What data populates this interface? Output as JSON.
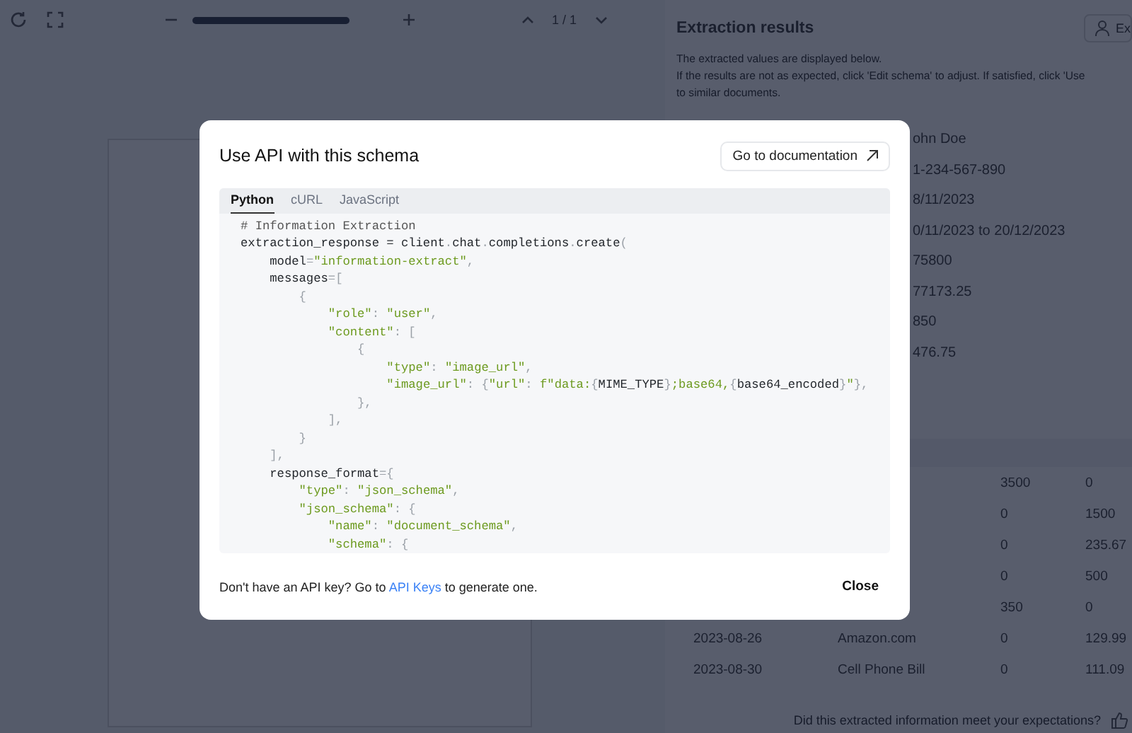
{
  "toolbar": {
    "zoom": {
      "level": 1
    },
    "page_indicator": "1 / 1"
  },
  "results": {
    "title": "Extraction results",
    "action_label": "Ex",
    "description": [
      "The extracted values are displayed below.",
      "If the results are not as expected, click 'Edit schema' to adjust. If satisfied, click 'Use",
      "to similar documents."
    ],
    "field_values": [
      "ohn Doe",
      "1-234-567-890",
      "8/11/2023",
      "0/11/2023 to 20/12/2023",
      "75800",
      "77173.25",
      "850",
      "476.75"
    ],
    "table_rows": [
      {
        "column_3": "3500",
        "column_4": "0"
      },
      {
        "column_3": "0",
        "column_4": "1500"
      },
      {
        "column_3": "0",
        "column_4": "235.67"
      },
      {
        "column_3": "0",
        "column_4": "500"
      },
      {
        "column_3": "350",
        "column_4": "0"
      },
      {
        "column_1": "2023-08-26",
        "column_2": "Amazon.com",
        "column_3": "0",
        "column_4": "129.99"
      },
      {
        "column_1": "2023-08-30",
        "column_2": "Cell Phone Bill",
        "column_3": "0",
        "column_4": "111.09"
      }
    ],
    "feedback_prompt": "Did this extracted information meet your expectations?"
  },
  "modal": {
    "title": "Use API with this schema",
    "doc_button": "Go to documentation",
    "tabs": [
      {
        "label": "Python",
        "selected": true
      },
      {
        "label": "cURL",
        "selected": false
      },
      {
        "label": "JavaScript",
        "selected": false
      }
    ],
    "code_lines": [
      [
        {
          "kind": "comment",
          "text": "# Information Extraction"
        }
      ],
      [
        {
          "kind": "plain",
          "text": "extraction_response = client"
        },
        {
          "kind": "punct",
          "text": "."
        },
        {
          "kind": "plain",
          "text": "chat"
        },
        {
          "kind": "punct",
          "text": "."
        },
        {
          "kind": "plain",
          "text": "completions"
        },
        {
          "kind": "punct",
          "text": "."
        },
        {
          "kind": "plain",
          "text": "create"
        },
        {
          "kind": "punct",
          "text": "("
        }
      ],
      [
        {
          "kind": "plain",
          "text": "    model"
        },
        {
          "kind": "punct",
          "text": "="
        },
        {
          "kind": "string",
          "text": "\"information-extract\""
        },
        {
          "kind": "punct",
          "text": ","
        }
      ],
      [
        {
          "kind": "plain",
          "text": "    messages"
        },
        {
          "kind": "punct",
          "text": "=["
        }
      ],
      [
        {
          "kind": "punct",
          "text": "        {"
        }
      ],
      [
        {
          "kind": "string",
          "text": "            \"role\""
        },
        {
          "kind": "punct",
          "text": ": "
        },
        {
          "kind": "string",
          "text": "\"user\""
        },
        {
          "kind": "punct",
          "text": ","
        }
      ],
      [
        {
          "kind": "string",
          "text": "            \"content\""
        },
        {
          "kind": "punct",
          "text": ": ["
        }
      ],
      [
        {
          "kind": "punct",
          "text": "                {"
        }
      ],
      [
        {
          "kind": "string",
          "text": "                    \"type\""
        },
        {
          "kind": "punct",
          "text": ": "
        },
        {
          "kind": "string",
          "text": "\"image_url\""
        },
        {
          "kind": "punct",
          "text": ","
        }
      ],
      [
        {
          "kind": "string",
          "text": "                    \"image_url\""
        },
        {
          "kind": "punct",
          "text": ": {"
        },
        {
          "kind": "string",
          "text": "\"url\""
        },
        {
          "kind": "punct",
          "text": ": "
        },
        {
          "kind": "string",
          "text": "f\"data:"
        },
        {
          "kind": "punct",
          "text": "{"
        },
        {
          "kind": "plain",
          "text": "MIME_TYPE"
        },
        {
          "kind": "punct",
          "text": "}"
        },
        {
          "kind": "string",
          "text": ";base64,"
        },
        {
          "kind": "punct",
          "text": "{"
        },
        {
          "kind": "plain",
          "text": "base64_encoded"
        },
        {
          "kind": "punct",
          "text": "}"
        },
        {
          "kind": "string",
          "text": "\""
        },
        {
          "kind": "punct",
          "text": "},"
        }
      ],
      [
        {
          "kind": "punct",
          "text": "                },"
        }
      ],
      [
        {
          "kind": "punct",
          "text": "            ],"
        }
      ],
      [
        {
          "kind": "punct",
          "text": "        }"
        }
      ],
      [
        {
          "kind": "punct",
          "text": "    ],"
        }
      ],
      [
        {
          "kind": "plain",
          "text": "    response_format"
        },
        {
          "kind": "punct",
          "text": "={"
        }
      ],
      [
        {
          "kind": "string",
          "text": "        \"type\""
        },
        {
          "kind": "punct",
          "text": ": "
        },
        {
          "kind": "string",
          "text": "\"json_schema\""
        },
        {
          "kind": "punct",
          "text": ","
        }
      ],
      [
        {
          "kind": "string",
          "text": "        \"json_schema\""
        },
        {
          "kind": "punct",
          "text": ": {"
        }
      ],
      [
        {
          "kind": "string",
          "text": "            \"name\""
        },
        {
          "kind": "punct",
          "text": ": "
        },
        {
          "kind": "string",
          "text": "\"document_schema\""
        },
        {
          "kind": "punct",
          "text": ","
        }
      ],
      [
        {
          "kind": "string",
          "text": "            \"schema\""
        },
        {
          "kind": "punct",
          "text": ": {"
        }
      ]
    ],
    "footer": {
      "before": "Don't have an API key? Go to",
      "link": "API Keys",
      "after": "to generate one."
    },
    "close_button": "Close"
  }
}
